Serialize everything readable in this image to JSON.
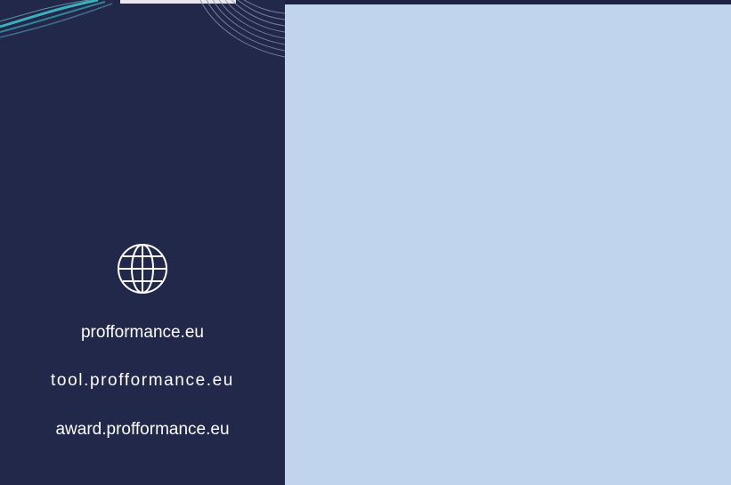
{
  "colors": {
    "left_panel_bg": "#22284a",
    "right_panel_bg": "#c0d4ee",
    "text": "#ffffff",
    "accent_teal": "#3fc0c8"
  },
  "icons": {
    "globe": "globe-icon"
  },
  "links": [
    {
      "label": "profformance.eu"
    },
    {
      "label": "tool.profformance.eu"
    },
    {
      "label": "award.profformance.eu"
    }
  ]
}
